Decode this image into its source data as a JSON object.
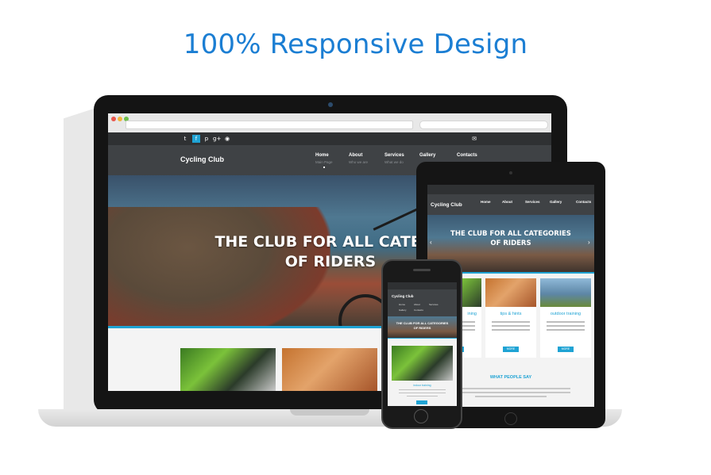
{
  "headline": "100% Responsive Design",
  "colors": {
    "accent": "#1fa3d4",
    "headline": "#1b7ed3",
    "nav_bg": "#3f4245"
  },
  "desktop": {
    "social_icons": [
      "twitter-icon",
      "facebook-icon",
      "pinterest-icon",
      "google-plus-icon",
      "rss-icon"
    ],
    "social_glyphs": [
      "t",
      "f",
      "p",
      "g+",
      "◉"
    ],
    "mail_glyph": "✉",
    "logo": "Cycling Club",
    "nav": [
      {
        "label": "Home",
        "sub": "Main Page"
      },
      {
        "label": "About",
        "sub": "Who we are"
      },
      {
        "label": "Services",
        "sub": "What we do"
      },
      {
        "label": "Gallery",
        "sub": ""
      },
      {
        "label": "Contacts",
        "sub": ""
      }
    ],
    "hero_line1": "THE CLUB FOR ALL CATEGO",
    "hero_line2": "OF RIDERS"
  },
  "tablet": {
    "logo": "Cycling Club",
    "nav": [
      {
        "label": "Home"
      },
      {
        "label": "About"
      },
      {
        "label": "Services"
      },
      {
        "label": "Gallery"
      },
      {
        "label": "Contacts"
      }
    ],
    "hero_line1": "THE CLUB FOR ALL CATEGORIES",
    "hero_line2": "OF RIDERS",
    "cards": [
      {
        "title": "ining",
        "more": "MORE"
      },
      {
        "title": "tips & hints",
        "more": "MORE"
      },
      {
        "title": "outdoor training",
        "more": "MORE"
      }
    ],
    "testimonials_title": "WHAT PEOPLE SAY",
    "arrow_left": "‹",
    "arrow_right": "›"
  },
  "phone": {
    "logo": "Cycling Club",
    "nav": [
      "Home",
      "About",
      "Services",
      "Gallery",
      "Contacts"
    ],
    "hero_line1": "THE CLUB FOR ALL CATEGORIES",
    "hero_line2": "OF RIDERS",
    "caption": "indoor training"
  }
}
